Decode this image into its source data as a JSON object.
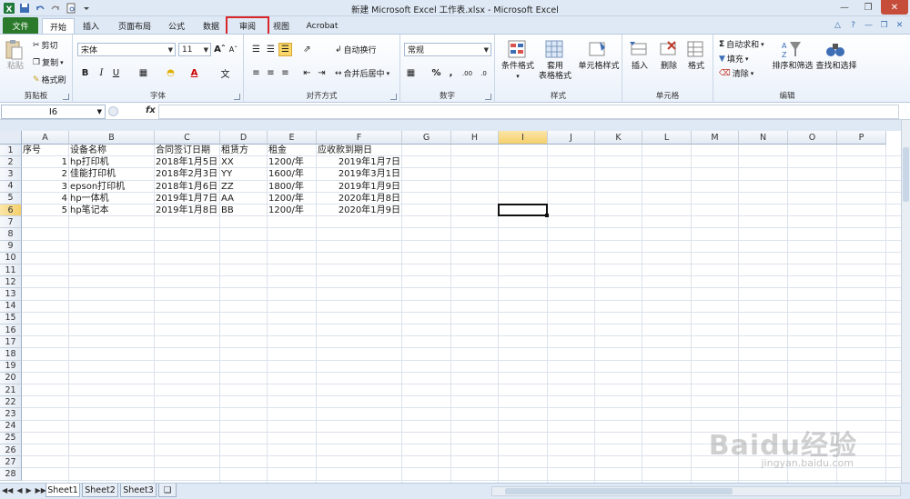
{
  "window": {
    "title": "新建 Microsoft Excel 工作表.xlsx - Microsoft Excel"
  },
  "tabs": {
    "file": "文件",
    "items": [
      "开始",
      "插入",
      "页面布局",
      "公式",
      "数据",
      "审阅",
      "视图",
      "Acrobat"
    ],
    "active": "开始",
    "highlighted": "审阅"
  },
  "ribbon": {
    "clipboard": {
      "label": "剪贴板",
      "paste": "粘贴",
      "cut": "剪切",
      "copy": "复制",
      "format_painter": "格式刷"
    },
    "font": {
      "label": "字体",
      "font_name": "宋体",
      "font_size": "11"
    },
    "alignment": {
      "label": "对齐方式",
      "wrap": "自动换行",
      "merge": "合并后居中"
    },
    "number": {
      "label": "数字",
      "format": "常规"
    },
    "styles": {
      "label": "样式",
      "conditional": "条件格式",
      "table_format_1": "套用",
      "table_format_2": "表格格式",
      "cell_styles": "单元格样式"
    },
    "cells": {
      "label": "单元格",
      "insert": "插入",
      "delete": "删除",
      "format": "格式"
    },
    "editing": {
      "label": "编辑",
      "autosum": "自动求和",
      "fill": "填充",
      "clear": "清除",
      "sort": "排序和筛选",
      "find": "查找和选择"
    }
  },
  "formula_bar": {
    "name_box": "I6",
    "fx": "fx",
    "value": ""
  },
  "grid": {
    "columns": [
      "A",
      "B",
      "C",
      "D",
      "E",
      "F",
      "G",
      "H",
      "I",
      "J",
      "K",
      "L",
      "M",
      "N",
      "O",
      "P"
    ],
    "selected_column": "I",
    "selected_row": 6,
    "rows": [
      "1",
      "2",
      "3",
      "4",
      "5",
      "6",
      "7",
      "8",
      "9",
      "10",
      "11",
      "12",
      "13",
      "14",
      "15",
      "16",
      "17",
      "18",
      "19",
      "20",
      "21",
      "22",
      "23",
      "24",
      "25",
      "26",
      "27",
      "28"
    ],
    "header": [
      "序号",
      "设备名称",
      "合同签订日期",
      "租赁方",
      "租金",
      "应收款到期日"
    ],
    "data": [
      [
        "1",
        "hp打印机",
        "2018年1月5日",
        "XX",
        "1200/年",
        "2019年1月7日"
      ],
      [
        "2",
        "佳能打印机",
        "2018年2月3日",
        "YY",
        "1600/年",
        "2019年3月1日"
      ],
      [
        "3",
        "epson打印机",
        "2018年1月6日",
        "ZZ",
        "1800/年",
        "2019年1月9日"
      ],
      [
        "4",
        "hp一体机",
        "2019年1月7日",
        "AA",
        "1200/年",
        "2020年1月8日"
      ],
      [
        "5",
        "hp笔记本",
        "2019年1月8日",
        "BB",
        "1200/年",
        "2020年1月9日"
      ]
    ]
  },
  "sheets": [
    "Sheet1",
    "Sheet2",
    "Sheet3"
  ],
  "active_sheet": "Sheet1",
  "watermark": {
    "main": "Baidu经验",
    "sub": "jingyan.baidu.com"
  }
}
